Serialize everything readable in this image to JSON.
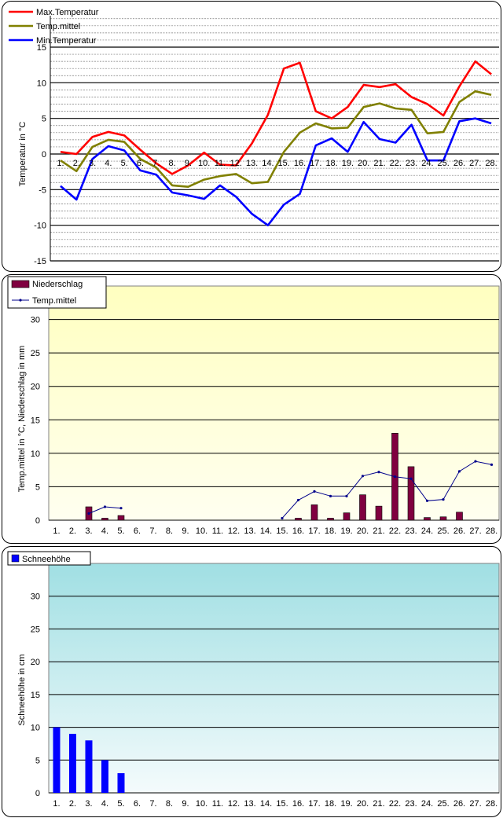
{
  "chart_data": [
    {
      "type": "line",
      "categories": [
        "1.",
        "2.",
        "3.",
        "4.",
        "5.",
        "6.",
        "7.",
        "8.",
        "9.",
        "10.",
        "11.",
        "12.",
        "13.",
        "14.",
        "15.",
        "16.",
        "17.",
        "18.",
        "19.",
        "20.",
        "21.",
        "22.",
        "23.",
        "24.",
        "25.",
        "26.",
        "27.",
        "28."
      ],
      "ylabel": "Temperatur  in °C",
      "ylim": [
        -15,
        15
      ],
      "ymajor": [
        15,
        10,
        5,
        0,
        -5,
        -10,
        -15
      ],
      "legend_position": "top-left",
      "grid": true,
      "series": [
        {
          "name": "Max.Temperatur",
          "color": "#ff0000",
          "values": [
            0.3,
            0.0,
            2.4,
            3.1,
            2.6,
            0.6,
            -1.3,
            -2.8,
            -1.6,
            0.2,
            -1.5,
            -1.6,
            1.5,
            5.5,
            12.0,
            12.8,
            6.0,
            5.0,
            6.6,
            9.7,
            9.4,
            9.8,
            8.0,
            7.0,
            5.4,
            9.5,
            13.0,
            11.2
          ]
        },
        {
          "name": "Temp.mittel",
          "color": "#808000",
          "values": [
            -0.9,
            -2.4,
            1.0,
            2.0,
            1.7,
            -0.7,
            -1.9,
            -4.4,
            -4.6,
            -3.6,
            -3.1,
            -2.8,
            -4.1,
            -3.9,
            0.3,
            3.0,
            4.3,
            3.6,
            3.7,
            6.6,
            7.1,
            6.4,
            6.2,
            2.9,
            3.1,
            7.3,
            8.8,
            8.3
          ]
        },
        {
          "name": "Min.Temperatur",
          "color": "#0000ff",
          "values": [
            -4.5,
            -6.4,
            -0.7,
            1.1,
            0.5,
            -2.3,
            -2.9,
            -5.4,
            -5.8,
            -6.3,
            -4.4,
            -6.0,
            -8.4,
            -10.0,
            -7.1,
            -5.6,
            1.2,
            2.2,
            0.3,
            4.5,
            2.1,
            1.6,
            4.1,
            -0.9,
            -0.9,
            4.6,
            5.0,
            4.3
          ]
        }
      ]
    },
    {
      "type": "bar",
      "categories": [
        "1.",
        "2.",
        "3.",
        "4.",
        "5.",
        "6.",
        "7.",
        "8.",
        "9.",
        "10.",
        "11.",
        "12.",
        "13.",
        "14.",
        "15.",
        "16.",
        "17.",
        "18.",
        "19.",
        "20.",
        "21.",
        "22.",
        "23.",
        "24.",
        "25.",
        "26.",
        "27.",
        "28."
      ],
      "ylabel": "Temp.mittel  in °C, Niederschlag in mm",
      "ylim": [
        0,
        35
      ],
      "yticks": [
        0,
        5,
        10,
        15,
        20,
        25,
        30
      ],
      "legend_position": "top-left",
      "series": [
        {
          "name": "Niederschlag",
          "kind": "bar",
          "color": "#800040",
          "values": [
            0,
            0,
            2.0,
            0.3,
            0.7,
            0,
            0,
            0,
            0,
            0,
            0,
            0,
            0,
            0,
            0,
            0.3,
            2.3,
            0.3,
            1.1,
            3.8,
            2.1,
            13.0,
            8.0,
            0.4,
            0.5,
            1.2,
            0,
            0
          ]
        },
        {
          "name": "Temp.mittel",
          "kind": "line",
          "color": "#00008b",
          "values": [
            null,
            null,
            1.0,
            2.0,
            1.8,
            null,
            null,
            null,
            null,
            null,
            null,
            null,
            null,
            null,
            0.3,
            3.0,
            4.3,
            3.6,
            3.6,
            6.6,
            7.2,
            6.5,
            6.2,
            2.9,
            3.1,
            7.3,
            8.8,
            8.3
          ]
        }
      ]
    },
    {
      "type": "bar",
      "categories": [
        "1.",
        "2.",
        "3.",
        "4.",
        "5.",
        "6.",
        "7.",
        "8.",
        "9.",
        "10.",
        "11.",
        "12.",
        "13.",
        "14.",
        "15.",
        "16.",
        "17.",
        "18.",
        "19.",
        "20.",
        "21.",
        "22.",
        "23.",
        "24.",
        "25.",
        "26.",
        "27.",
        "28."
      ],
      "ylabel": "Schneehöhe in cm",
      "ylim": [
        0,
        35
      ],
      "yticks": [
        0,
        5,
        10,
        15,
        20,
        25,
        30
      ],
      "legend_position": "top-left",
      "series": [
        {
          "name": "Schneehöhe",
          "color": "#0000ff",
          "values": [
            10,
            9,
            8,
            5,
            3,
            0,
            0,
            0,
            0,
            0,
            0,
            0,
            0,
            0,
            0,
            0,
            0,
            0,
            0,
            0,
            0,
            0,
            0,
            0,
            0,
            0,
            0,
            0
          ]
        }
      ]
    }
  ]
}
